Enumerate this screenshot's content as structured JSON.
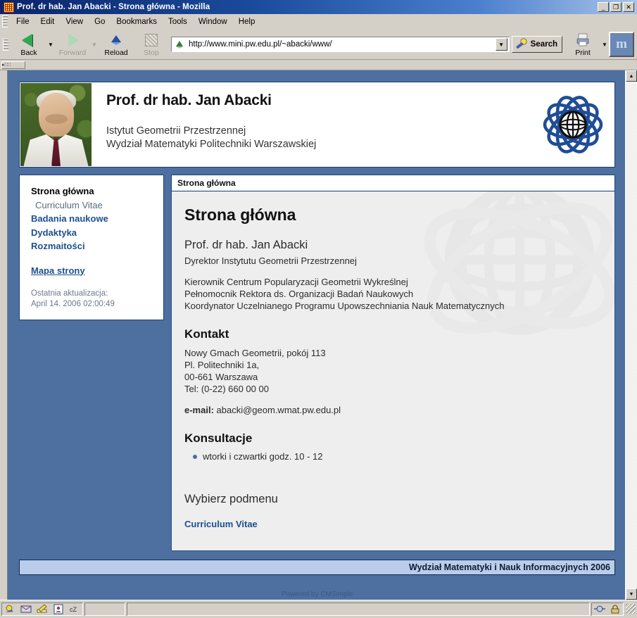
{
  "window": {
    "title": "Prof. dr hab. Jan Abacki - Strona główna - Mozilla",
    "minimize": "_",
    "maximize": "❐",
    "close": "✕"
  },
  "menubar": [
    {
      "label": "File"
    },
    {
      "label": "Edit"
    },
    {
      "label": "View"
    },
    {
      "label": "Go"
    },
    {
      "label": "Bookmarks"
    },
    {
      "label": "Tools"
    },
    {
      "label": "Window"
    },
    {
      "label": "Help"
    }
  ],
  "toolbar": {
    "back": "Back",
    "forward": "Forward",
    "reload": "Reload",
    "stop": "Stop",
    "search": "Search",
    "print": "Print",
    "dropdown_glyph": "▼",
    "mozilla_logo": "m"
  },
  "address": {
    "url": "http://www.mini.pw.edu.pl/~abacki/www/",
    "dropdown_glyph": "▼"
  },
  "site": {
    "header": {
      "name": "Prof. dr hab. Jan Abacki",
      "affiliation_line1": "Istytut Geometrii Przestrzennej",
      "affiliation_line2": "Wydział Matematyki Politechniki Warszawskiej"
    },
    "sidebar": {
      "items": [
        {
          "label": "Strona główna",
          "level": 1,
          "active": true
        },
        {
          "label": "Curriculum Vitae",
          "level": 2,
          "active": false
        },
        {
          "label": "Badania naukowe",
          "level": 1,
          "active": false
        },
        {
          "label": "Dydaktyka",
          "level": 1,
          "active": false
        },
        {
          "label": "Rozmaitości",
          "level": 1,
          "active": false
        }
      ],
      "sitemap": "Mapa strony",
      "update_label": "Ostatnia aktualizacja:",
      "update_value": "April 14. 2006 02:00:49"
    },
    "breadcrumb": "Strona główna",
    "content": {
      "h1": "Strona główna",
      "lead": "Prof. dr hab. Jan Abacki",
      "role": "Dyrektor Instytutu Geometrii Przestrzennej",
      "roles_extra": [
        "Kierownik Centrum Popularyzacji Geometrii Wykreślnej",
        "Pełnomocnik Rektora ds. Organizacji Badań Naukowych",
        "Koordynator Uczelnianego Programu Upowszechniania Nauk Matematycznych"
      ],
      "contact_heading": "Kontakt",
      "contact_lines": [
        "Nowy Gmach Geometrii, pokój 113",
        "Pl. Politechniki 1a,",
        "00-661 Warszawa",
        "Tel: (0-22) 660 00 00"
      ],
      "email_label": "e-mail:",
      "email_value": "abacki@geom.wmat.pw.edu.pl",
      "consult_heading": "Konsultacje",
      "consult_item": "wtorki i czwartki godz. 10 - 12",
      "submenu_heading": "Wybierz podmenu",
      "submenu_link": "Curriculum Vitae"
    },
    "footer": {
      "band": "Wydział Matematyki i Nauk Informacyjnych 2006",
      "powered": "Powered by CMSimple"
    }
  },
  "scrollbar": {
    "up": "▲",
    "down": "▼"
  },
  "statusbar": {
    "message": ""
  },
  "colors": {
    "titlebar_start": "#0a246a",
    "page_bg": "#4d70a0",
    "content_bg": "#eeeeee",
    "link": "#1d4f8f",
    "footer_band": "#b9cdeb",
    "border": "#1b3f72",
    "chrome": "#d4d0c8"
  }
}
